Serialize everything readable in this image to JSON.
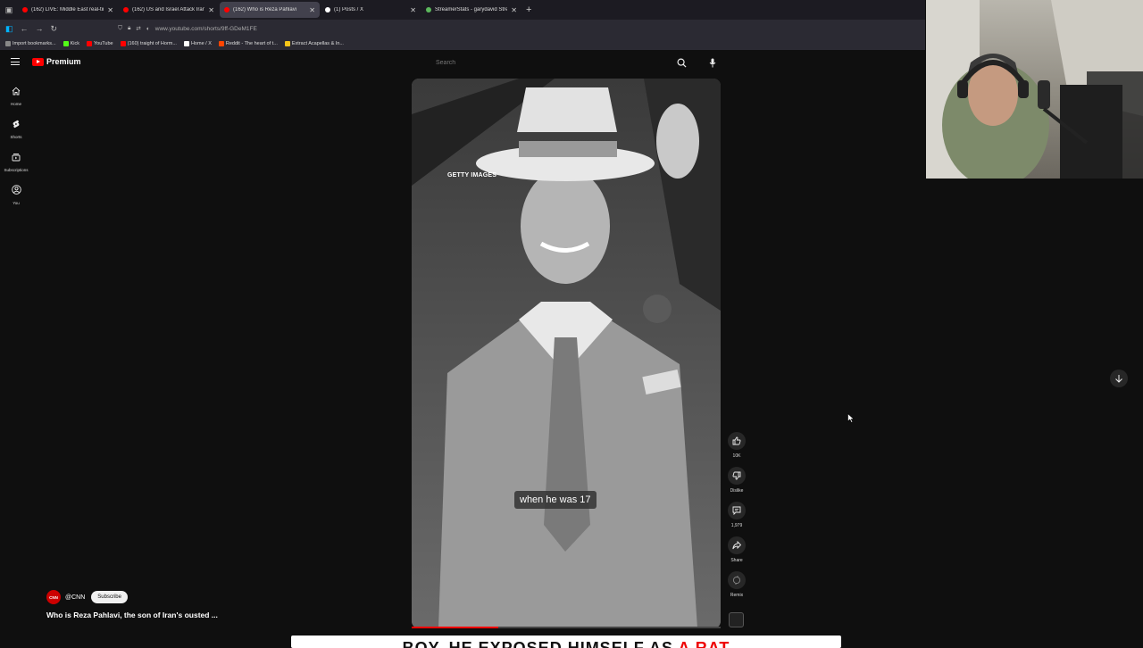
{
  "browser": {
    "tabs": [
      {
        "title": "(162) LIVE: Middle East real-tim",
        "fav_color": "#ff0000",
        "active": false
      },
      {
        "title": "(162) US and Israel Attack Iran",
        "fav_color": "#ff0000",
        "active": false
      },
      {
        "title": "(162) Who is Reza Pahlavi",
        "fav_color": "#ff0000",
        "active": true
      },
      {
        "title": "(1) Posts / X",
        "fav_color": "#ffffff",
        "active": false
      },
      {
        "title": "StreamerStats - garydavid Strea",
        "fav_color": "#5cb85c",
        "active": false
      }
    ],
    "url": "www.youtube.com/shorts/9ff-GDeM1FE",
    "bookmarks": [
      {
        "label": "Import bookmarks...",
        "color": "#888888"
      },
      {
        "label": "Kick",
        "color": "#53fc18"
      },
      {
        "label": "YouTube",
        "color": "#ff0000"
      },
      {
        "label": "(160) traight of Horm...",
        "color": "#ff0000"
      },
      {
        "label": "Home / X",
        "color": "#ffffff"
      },
      {
        "label": "Reddit - The heart of t...",
        "color": "#ff4500"
      },
      {
        "label": "Extract Acapellas & In...",
        "color": "#f5c518"
      }
    ]
  },
  "youtube": {
    "logo_text": "Premium",
    "search_placeholder": "Search",
    "sidebar": [
      {
        "label": "Home",
        "icon": "home-icon"
      },
      {
        "label": "Shorts",
        "icon": "shorts-icon"
      },
      {
        "label": "Subscriptions",
        "icon": "subscriptions-icon"
      },
      {
        "label": "You",
        "icon": "you-icon"
      }
    ],
    "short": {
      "watermark": "GETTY IMAGES",
      "caption": "when he was 17",
      "progress": 0.28,
      "channel_avatar_text": "CNN",
      "channel_handle": "@CNN",
      "subscribe_label": "Subscribe",
      "title": "Who is Reza Pahlavi, the son of Iran's ousted ..."
    },
    "actions": {
      "like": "10K",
      "dislike": "Dislike",
      "comments": "1,979",
      "share": "Share",
      "remix": "Remix"
    }
  },
  "overlay_banner": {
    "text_dark": "BOY, HE EXPOSED HIMSELF AS ",
    "text_red": "A RAT"
  }
}
